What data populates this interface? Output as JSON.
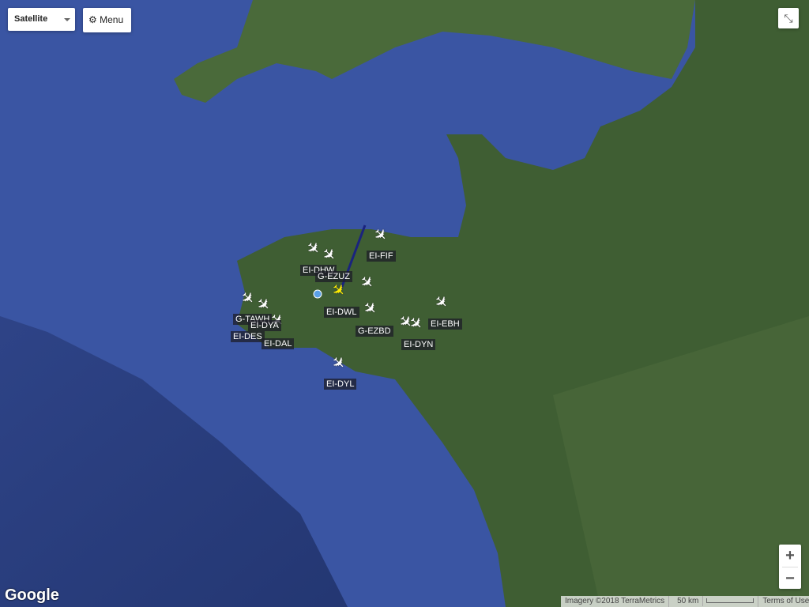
{
  "controls": {
    "map_type": "Satellite",
    "menu": "Menu",
    "zoom_in": "+",
    "zoom_out": "−"
  },
  "flights": [
    {
      "reg": "EI-DHW"
    },
    {
      "reg": "G-EZUZ",
      "selected": true
    },
    {
      "reg": "EI-FIF"
    },
    {
      "reg": "EI-DWL"
    },
    {
      "reg": "G-EZBD"
    },
    {
      "reg": "G-TAWH"
    },
    {
      "reg": "EI-DYA"
    },
    {
      "reg": "EI-DES"
    },
    {
      "reg": "EI-DAL"
    },
    {
      "reg": "EI-DYL"
    },
    {
      "reg": "EI-EBH"
    },
    {
      "reg": "EI-DYN"
    }
  ],
  "attribution": {
    "imagery": "Imagery ©2018 TerraMetrics",
    "scale": "50 km",
    "terms": "Terms of Use"
  },
  "logo": "Google",
  "colors": {
    "sea": "#3a55a3",
    "land": "#3f5e33",
    "track": "#1a237e",
    "selected": "#ffee00"
  }
}
